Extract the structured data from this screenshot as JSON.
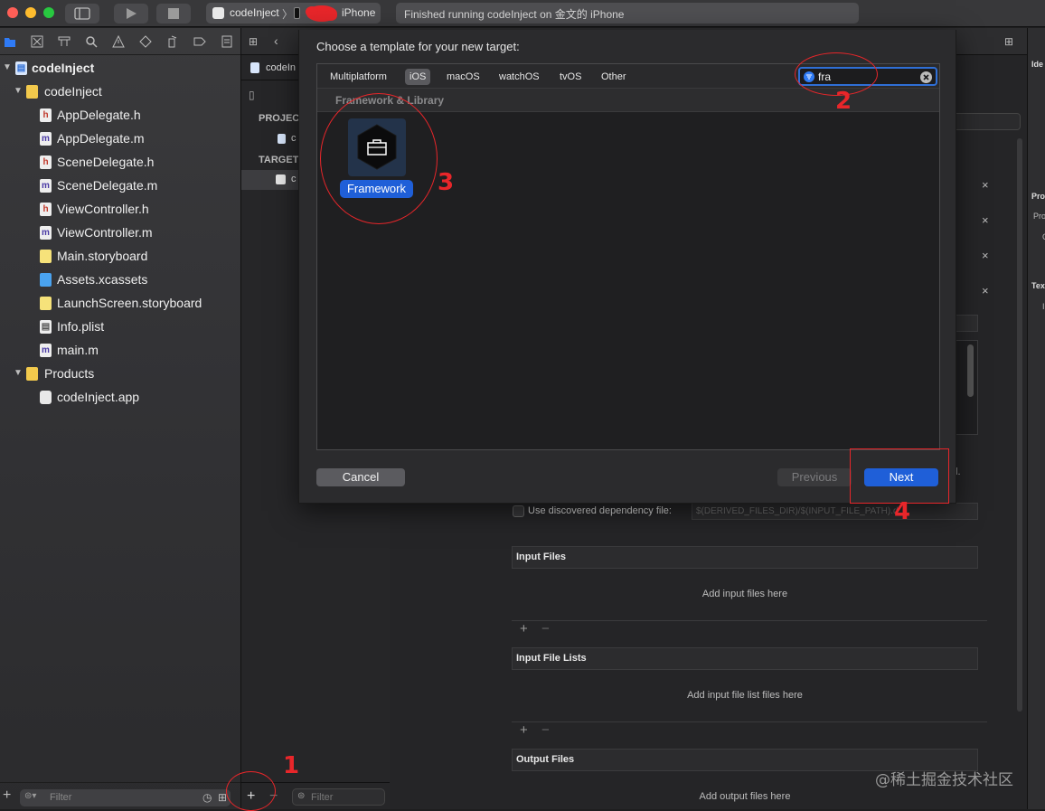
{
  "toolbar": {
    "scheme_target": "codeInject",
    "scheme_separator": "〉",
    "device": "iPhone",
    "status": "Finished running codeInject on 金文的 iPhone"
  },
  "navigator": {
    "filter_placeholder": "Filter",
    "tree": [
      {
        "label": "codeInject",
        "kind": "project",
        "level": 0,
        "expanded": true
      },
      {
        "label": "codeInject",
        "kind": "folder",
        "level": 1,
        "expanded": true
      },
      {
        "label": "AppDelegate.h",
        "kind": "h",
        "level": 2
      },
      {
        "label": "AppDelegate.m",
        "kind": "m",
        "level": 2
      },
      {
        "label": "SceneDelegate.h",
        "kind": "h",
        "level": 2
      },
      {
        "label": "SceneDelegate.m",
        "kind": "m",
        "level": 2
      },
      {
        "label": "ViewController.h",
        "kind": "h",
        "level": 2
      },
      {
        "label": "ViewController.m",
        "kind": "m",
        "level": 2
      },
      {
        "label": "Main.storyboard",
        "kind": "storyboard",
        "level": 2
      },
      {
        "label": "Assets.xcassets",
        "kind": "assets",
        "level": 2
      },
      {
        "label": "LaunchScreen.storyboard",
        "kind": "storyboard",
        "level": 2
      },
      {
        "label": "Info.plist",
        "kind": "plist",
        "level": 2
      },
      {
        "label": "main.m",
        "kind": "m",
        "level": 2
      },
      {
        "label": "Products",
        "kind": "folder",
        "level": 1,
        "expanded": true
      },
      {
        "label": "codeInject.app",
        "kind": "app",
        "level": 2
      }
    ]
  },
  "middle": {
    "tab_label": "codeIn",
    "project_header": "PROJEC",
    "project_item": "c",
    "targets_header": "TARGET",
    "target_item": "c",
    "add_button": "+",
    "remove_button": "−",
    "filter_placeholder": "Filter"
  },
  "inspector": {
    "ide": "Ide",
    "pro": "Pro",
    "pro2": "Pro",
    "c": "C",
    "tex": "Tex",
    "i": "I"
  },
  "editor": {
    "dependency_label": "Use discovered dependency file:",
    "dependency_value": "$(DERIVED_FILES_DIR)/$(INPUT_FILE_PATH).d",
    "input_files": "Input Files",
    "input_files_hint": "Add input files here",
    "input_file_lists": "Input File Lists",
    "input_file_lists_hint": "Add input file list files here",
    "output_files": "Output Files",
    "output_files_hint": "Add output files here",
    "period": "l.",
    "close": "×"
  },
  "dialog": {
    "title": "Choose a template for your new target:",
    "platform_tabs": [
      "Multiplatform",
      "iOS",
      "macOS",
      "watchOS",
      "tvOS",
      "Other"
    ],
    "selected_tab": "iOS",
    "search_value": "fra",
    "category": "Framework & Library",
    "template_label": "Framework",
    "cancel": "Cancel",
    "previous": "Previous",
    "next": "Next"
  },
  "annotations": {
    "n1": "1",
    "n2": "2",
    "n3": "3",
    "n4": "4",
    "color": "#e8262a"
  },
  "watermark": "@稀土掘金技术社区",
  "colors": {
    "accent": "#1f5fd8",
    "toolbar": "#38383a",
    "folder": "#f2c94c"
  }
}
